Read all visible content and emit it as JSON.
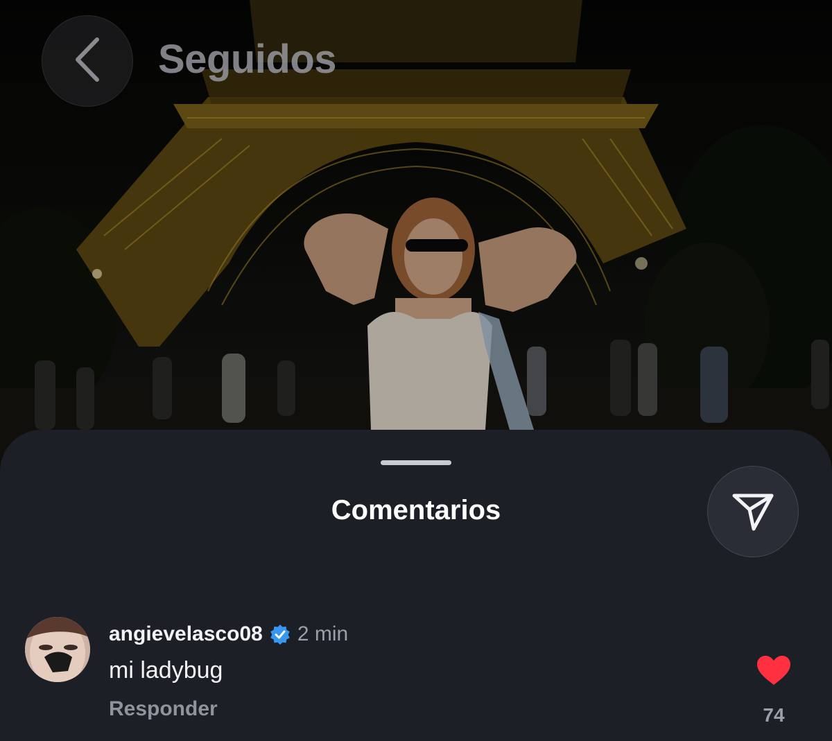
{
  "header": {
    "title": "Seguidos",
    "back_icon": "chevron-left-icon"
  },
  "post": {
    "image_subject": "photo-night-eiffel-tower"
  },
  "comments_sheet": {
    "title": "Comentarios",
    "send_icon": "send-icon",
    "comments": [
      {
        "username": "angievelasco08",
        "verified": true,
        "time": "2 min",
        "text": "mi ladybug",
        "reply_label": "Responder",
        "likes": "74",
        "liked": true
      }
    ]
  },
  "colors": {
    "sheet_bg": "#1c1f26",
    "like_red": "#ff3040",
    "verified_blue": "#3897f0"
  }
}
